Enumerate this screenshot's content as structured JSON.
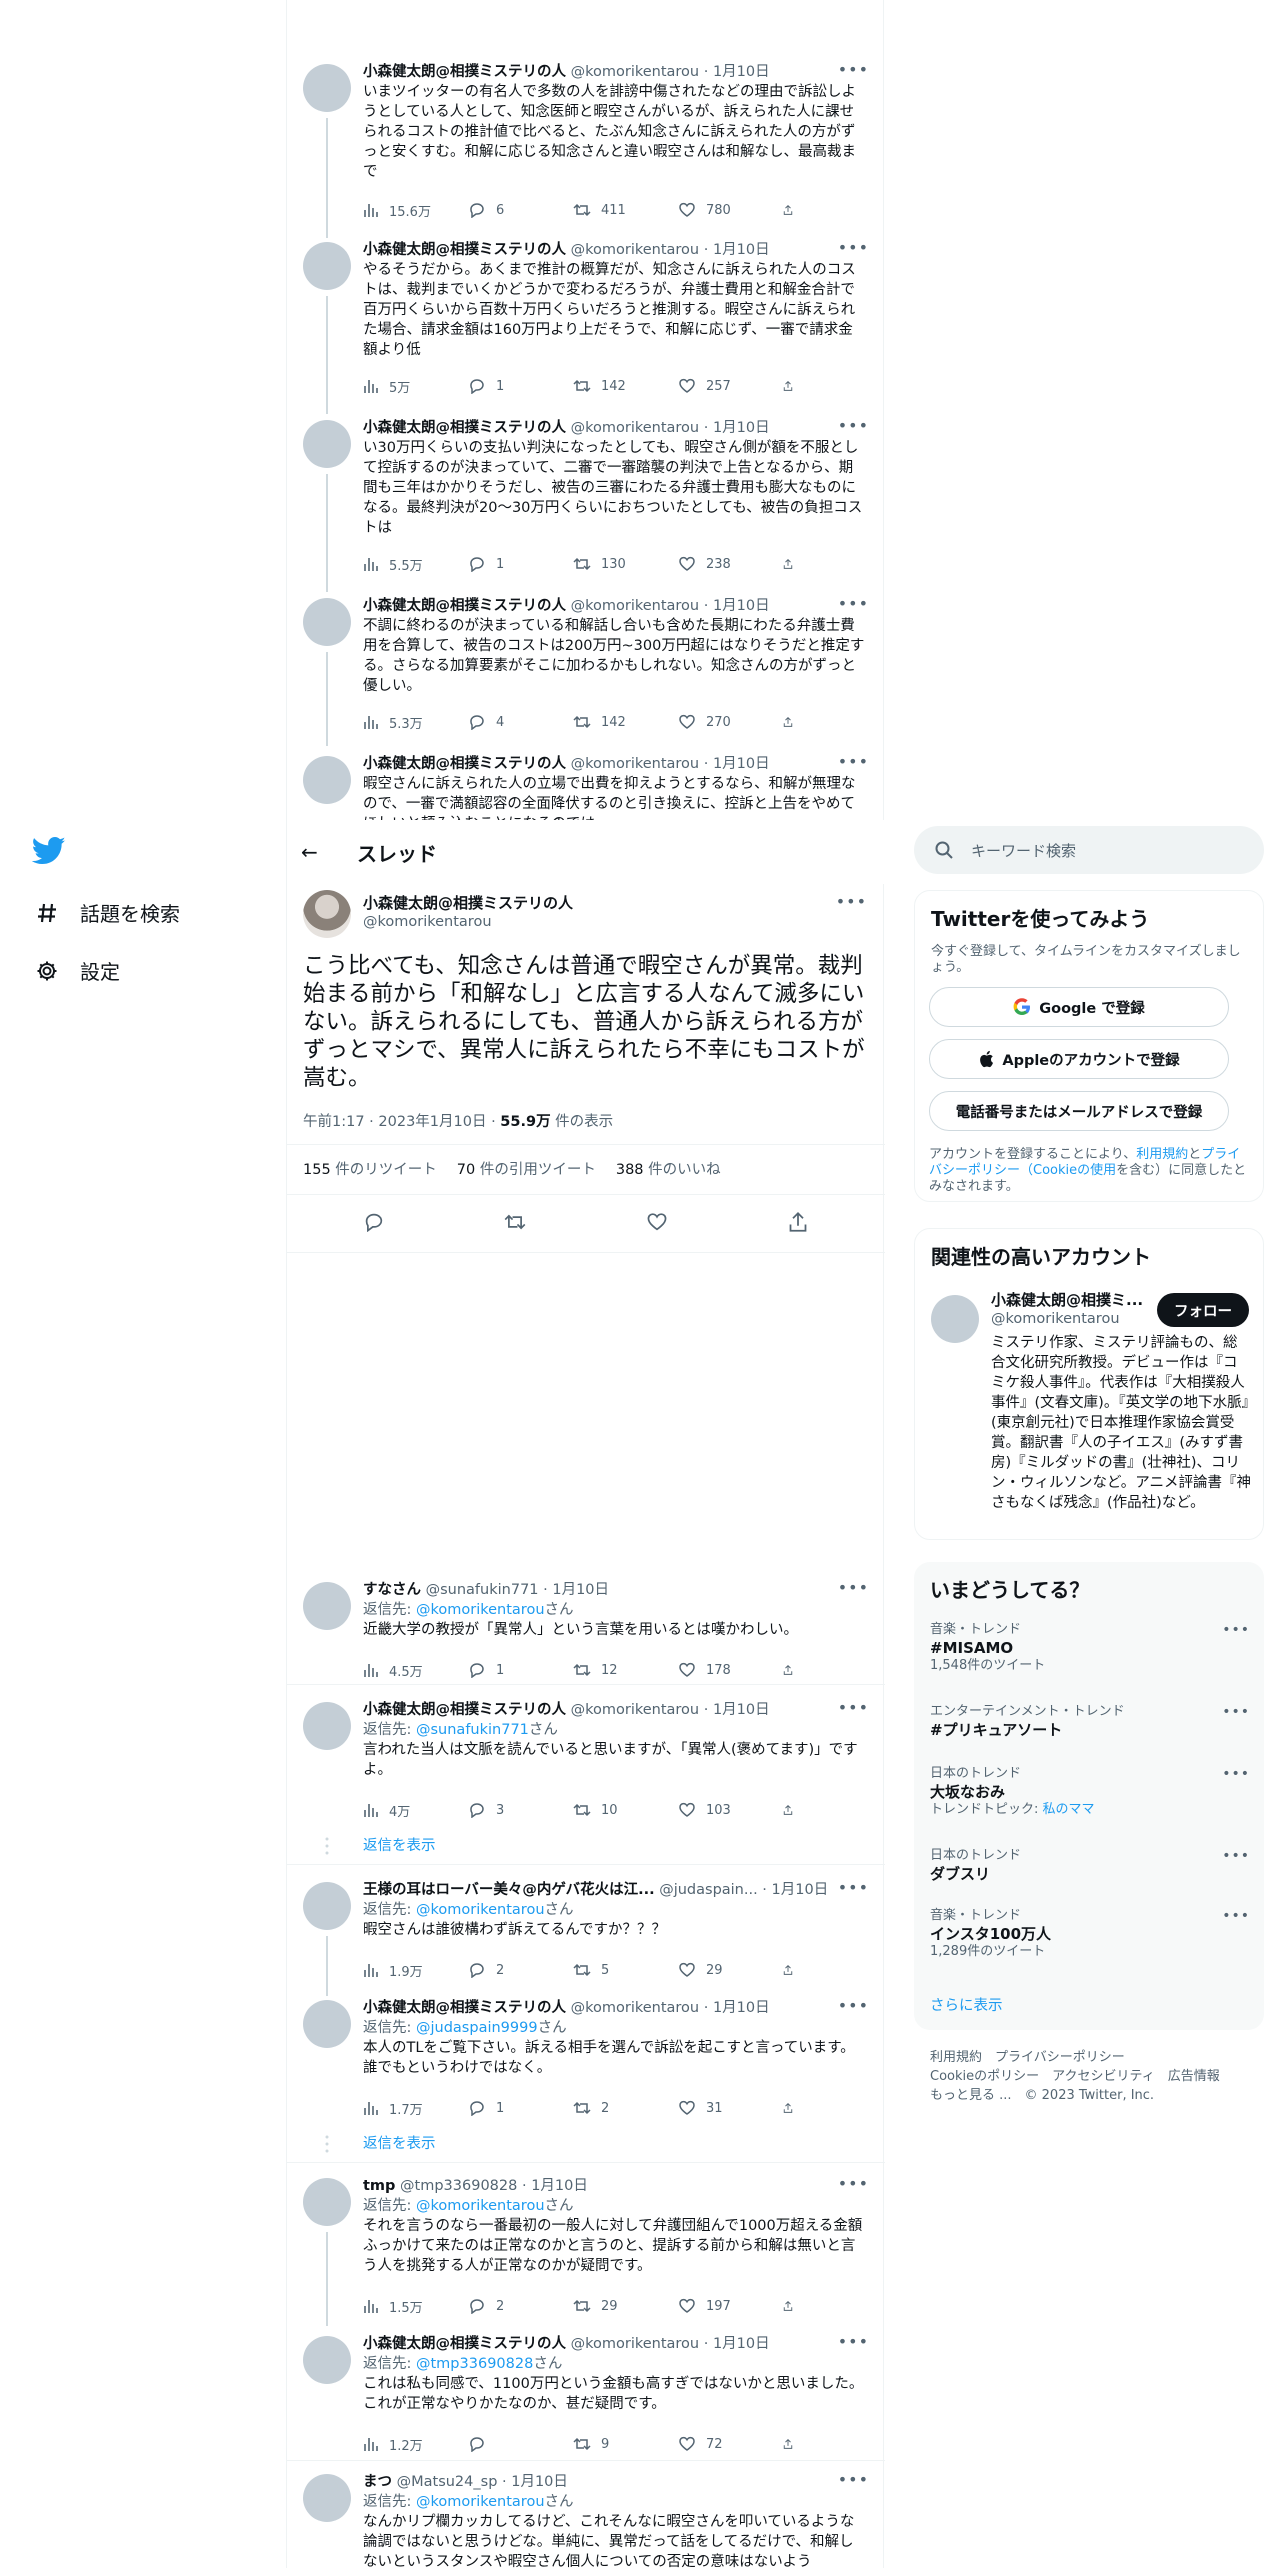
{
  "nav": {
    "bird_icon": "twitter-bird-icon",
    "items": [
      {
        "label": "話題を検索",
        "icon": "hashtag-icon"
      },
      {
        "label": "設定",
        "icon": "gear-icon"
      }
    ]
  },
  "author": {
    "name": "小森健太朗@相撲ミステリの人",
    "handle": "@komorikentarou",
    "date": "1月10日"
  },
  "thread_top": [
    {
      "text": "いまツイッターの有名人で多数の人を誹謗中傷されたなどの理由で訴訟しようとしている人として、知念医師と暇空さんがいるが、訴えられた人に課せられるコストの推計値で比べると、たぶん知念さんに訴えられた人の方がずっと安くすむ。和解に応じる知念さんと違い暇空さんは和解なし、最高裁まで",
      "views": "15.6万",
      "replies": "6",
      "retweets": "411",
      "likes": "780"
    },
    {
      "text": "やるそうだから。あくまで推計の概算だが、知念さんに訴えられた人のコストは、裁判までいくかどうかで変わるだろうが、弁護士費用と和解金合計で百万円くらいから百数十万円くらいだろうと推測する。暇空さんに訴えられた場合、請求金額は160万円より上だそうで、和解に応じず、一審で請求金額より低",
      "views": "5万",
      "replies": "1",
      "retweets": "142",
      "likes": "257"
    },
    {
      "text": "い30万円くらいの支払い判決になったとしても、暇空さん側が額を不服として控訴するのが決まっていて、二審で一審踏襲の判決で上告となるから、期間も三年はかかりそうだし、被告の三審にわたる弁護士費用も膨大なものになる。最終判決が20〜30万円くらいにおちついたとしても、被告の負担コストは",
      "views": "5.5万",
      "replies": "1",
      "retweets": "130",
      "likes": "238"
    },
    {
      "text": "不調に終わるのが決まっている和解話し合いも含めた長期にわたる弁護士費用を合算して、被告のコストは200万円~300万円超にはなりそうだと推定する。さらなる加算要素がそこに加わるかもしれない。知念さんの方がずっと優しい。",
      "views": "5.3万",
      "replies": "4",
      "retweets": "142",
      "likes": "270"
    },
    {
      "text": "暇空さんに訴えられた人の立場で出費を抑えようとするなら、和解が無理なので、一審で満額認容の全面降伏するのと引き換えに、控訴と上告をやめてほしいと頼み込むことになるのでは",
      "views": "",
      "replies": "",
      "retweets": "",
      "likes": ""
    }
  ],
  "thread_header": {
    "back": "←",
    "title": "スレッド"
  },
  "main_tweet": {
    "name": "小森健太朗@相撲ミステリの人",
    "handle": "@komorikentarou",
    "text": "こう比べても、知念さんは普通で暇空さんが異常。裁判始まる前から「和解なし」と広言する人なんて滅多にいない。訴えられるにしても、普通人から訴えられる方がずっとマシで、異常人に訴えられたら不幸にもコストが嵩む。",
    "time": "午前1:17 · 2023年1月10日 · ",
    "views_count": "55.9万",
    "views_label": " 件の表示",
    "retweets_count": "155",
    "retweets_label": " 件のリツイート",
    "quotes_count": "70",
    "quotes_label": " 件の引用ツイート",
    "likes_count": "388",
    "likes_label": " 件のいいね"
  },
  "replies": [
    {
      "name": "すなさん",
      "handle": "@sunafukin771",
      "date": "1月10日",
      "reply_prefix": "返信先: ",
      "reply_to": "@komorikentarou",
      "reply_suffix": "さん",
      "text": "近畿大学の教授が「異常人」という言葉を用いるとは嘆かわしい。",
      "views": "4.5万",
      "replies": "1",
      "retweets": "12",
      "likes": "178"
    },
    {
      "name": "小森健太朗@相撲ミステリの人",
      "handle": "@komorikentarou",
      "date": "1月10日",
      "reply_prefix": "返信先: ",
      "reply_to": "@sunafukin771",
      "reply_suffix": "さん",
      "text": "言われた当人は文脈を読んでいると思いますが、「異常人(褒めてます)」ですよ。",
      "views": "4万",
      "replies": "3",
      "retweets": "10",
      "likes": "103"
    },
    {
      "name": "王様の耳はローバー美々@内ゲバ花火は江...",
      "handle": "@judaspain...",
      "date": "1月10日",
      "reply_prefix": "返信先: ",
      "reply_to": "@komorikentarou",
      "reply_suffix": "さん",
      "text": "暇空さんは誰彼構わず訴えてるんですか？？？",
      "views": "1.9万",
      "replies": "2",
      "retweets": "5",
      "likes": "29"
    },
    {
      "name": "小森健太朗@相撲ミステリの人",
      "handle": "@komorikentarou",
      "date": "1月10日",
      "reply_prefix": "返信先: ",
      "reply_to": "@judaspain9999",
      "reply_suffix": "さん",
      "text": "本人のTLをご覧下さい。訴える相手を選んで訴訟を起こすと言っています。誰でもというわけではなく。",
      "views": "1.7万",
      "replies": "1",
      "retweets": "2",
      "likes": "31"
    },
    {
      "name": "tmp",
      "handle": "@tmp33690828",
      "date": "1月10日",
      "reply_prefix": "返信先: ",
      "reply_to": "@komorikentarou",
      "reply_suffix": "さん",
      "text": "それを言うのなら一番最初の一般人に対して弁護団組んで1000万超える金額ふっかけて来たのは正常なのかと言うのと、提訴する前から和解は無いと言う人を挑発する人が正常なのかが疑問です。",
      "views": "1.5万",
      "replies": "2",
      "retweets": "29",
      "likes": "197"
    },
    {
      "name": "小森健太朗@相撲ミステリの人",
      "handle": "@komorikentarou",
      "date": "1月10日",
      "reply_prefix": "返信先: ",
      "reply_to": "@tmp33690828",
      "reply_suffix": "さん",
      "text": "これは私も同感で、1100万円という金額も高すぎではないかと思いました。これが正常なやりかたなのか、甚だ疑問です。",
      "views": "1.2万",
      "replies": "",
      "retweets": "9",
      "likes": "72"
    },
    {
      "name": "まつ",
      "handle": "@Matsu24_sp",
      "date": "1月10日",
      "reply_prefix": "返信先: ",
      "reply_to": "@komorikentarou",
      "reply_suffix": "さん",
      "text": "なんかリプ欄カッカしてるけど、これそんなに暇空さんを叩いているような論調ではないと思うけどな。単純に、異常だって話をしてるだけで、和解しないというスタンスや暇空さん個人についての否定の意味はないよう",
      "views": "",
      "replies": "",
      "retweets": "",
      "likes": ""
    }
  ],
  "show_replies": "返信を表示",
  "right": {
    "search_placeholder": "キーワード検索",
    "signup": {
      "title": "Twitterを使ってみよう",
      "subtitle": "今すぐ登録して、タイムラインをカスタマイズしましょう。",
      "google": "Google で登録",
      "apple": "Appleのアカウントで登録",
      "phone": "電話番号またはメールアドレスで登録",
      "terms_pre": "アカウントを登録することにより、",
      "terms_link1": "利用規約",
      "terms_mid": "と",
      "terms_link2": "プライバシーポリシー（Cookieの使用",
      "terms_post": "を含む）に同意したとみなされます。"
    },
    "related": {
      "title": "関連性の高いアカウント",
      "name": "小森健太朗@相撲ミ...",
      "handle": "@komorikentarou",
      "follow": "フォロー",
      "bio": "ミステリ作家、ミステリ評論もの、総合文化研究所教授。デビュー作は『コミケ殺人事件』。代表作は『大相撲殺人事件』(文春文庫)。『英文学の地下水脈』(東京創元社)で日本推理作家協会賞受賞。翻訳書『人の子イエス』(みすず書房)『ミルダッドの書』(壮神社)、コリン・ウィルソンなど。アニメ評論書『神さもなくば残念』(作品社)など。"
    },
    "trends": {
      "title": "いまどうしてる？",
      "items": [
        {
          "category": "音楽・トレンド",
          "name": "#MISAMO",
          "count": "1,548件のツイート",
          "topic_prefix": "",
          "topic_link": ""
        },
        {
          "category": "エンターテインメント・トレンド",
          "name": "#プリキュアソート",
          "count": "",
          "topic_prefix": "",
          "topic_link": ""
        },
        {
          "category": "日本のトレンド",
          "name": "大坂なおみ",
          "count": "",
          "topic_prefix": "トレンドトピック: ",
          "topic_link": "私のママ"
        },
        {
          "category": "日本のトレンド",
          "name": "ダブスリ",
          "count": "",
          "topic_prefix": "",
          "topic_link": ""
        },
        {
          "category": "音楽・トレンド",
          "name": "インスタ100万人",
          "count": "1,289件のツイート",
          "topic_prefix": "",
          "topic_link": ""
        }
      ],
      "more": "さらに表示"
    },
    "footer": {
      "line1": "利用規約　プライバシーポリシー",
      "line2": "Cookieのポリシー　アクセシビリティ　広告情報",
      "line3": "もっと見る ...　© 2023 Twitter, Inc."
    }
  },
  "colors": {
    "accent": "#1d9bf0",
    "text": "#0f1419",
    "muted": "#536471",
    "avatar": "#c4ced6"
  }
}
